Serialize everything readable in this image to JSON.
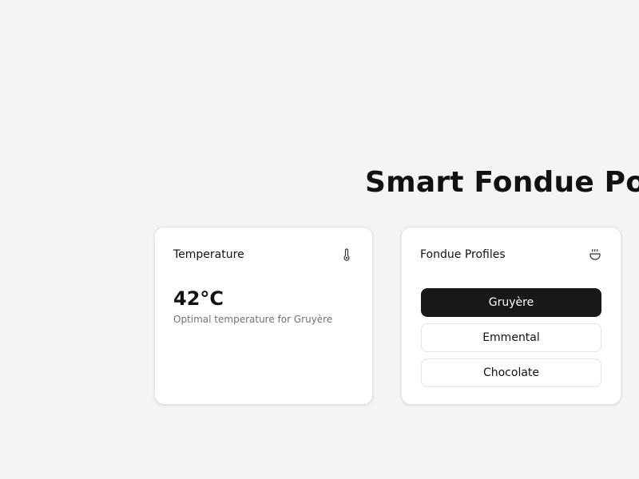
{
  "page": {
    "title": "Smart Fondue Pot"
  },
  "temperature_card": {
    "title": "Temperature",
    "icon": "thermometer-icon",
    "value": "42°C",
    "note": "Optimal temperature for Gruyère"
  },
  "profiles_card": {
    "title": "Fondue Profiles",
    "icon": "pot-icon",
    "selected": "Gruyère",
    "profiles": [
      {
        "label": "Gruyère",
        "active": true
      },
      {
        "label": "Emmental",
        "active": false
      },
      {
        "label": "Chocolate",
        "active": false
      }
    ]
  },
  "colors": {
    "background": "#f3f4f6",
    "card": "#ffffff",
    "active_button": "#18181b",
    "muted_text": "#6b7280"
  }
}
